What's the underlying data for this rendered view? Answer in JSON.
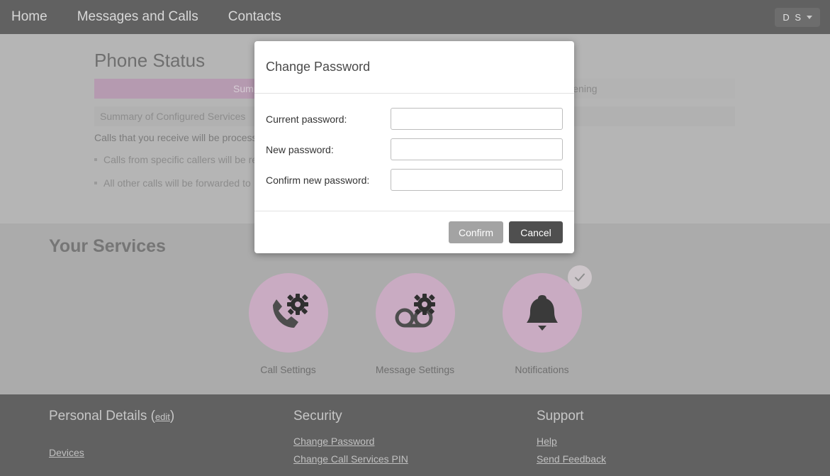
{
  "nav": {
    "items": [
      {
        "label": "Home"
      },
      {
        "label": "Messages and Calls"
      },
      {
        "label": "Contacts"
      }
    ],
    "user_initials": "D S"
  },
  "page": {
    "title": "Phone Status",
    "tabs": [
      {
        "label": "Summary",
        "active": true
      },
      {
        "label": "Screening",
        "active": false
      }
    ],
    "subbar_label": "Summary of Configured Services",
    "intro_text": "Calls that you receive will be process",
    "bullets": [
      "Calls from specific callers will be re",
      "All other calls will be forwarded to "
    ]
  },
  "services": {
    "title": "Your Services",
    "items": [
      {
        "label": "Call Settings",
        "icon": "phone-gear-icon",
        "badge": false
      },
      {
        "label": "Message Settings",
        "icon": "voicemail-gear-icon",
        "badge": false
      },
      {
        "label": "Notifications",
        "icon": "bell-icon",
        "badge": true
      }
    ]
  },
  "footer": {
    "personal": {
      "heading": "Personal Details",
      "edit_label": "edit",
      "links": [
        "Devices"
      ]
    },
    "security": {
      "heading": "Security",
      "links": [
        "Change Password",
        "Change Call Services PIN"
      ]
    },
    "support": {
      "heading": "Support",
      "links": [
        "Help",
        "Send Feedback"
      ]
    }
  },
  "modal": {
    "title": "Change Password",
    "fields": [
      {
        "label": "Current password:",
        "value": "",
        "placeholder": ""
      },
      {
        "label": "New password:",
        "value": "",
        "placeholder": ""
      },
      {
        "label": "Confirm new password:",
        "value": "",
        "placeholder": ""
      }
    ],
    "confirm_label": "Confirm",
    "cancel_label": "Cancel"
  },
  "colors": {
    "nav_bg": "#616161",
    "accent_mauve": "#b59ab0",
    "service_circle": "#c9abc2",
    "page_bg_upper": "#b5b5b5",
    "page_bg_mid": "#ababab"
  }
}
